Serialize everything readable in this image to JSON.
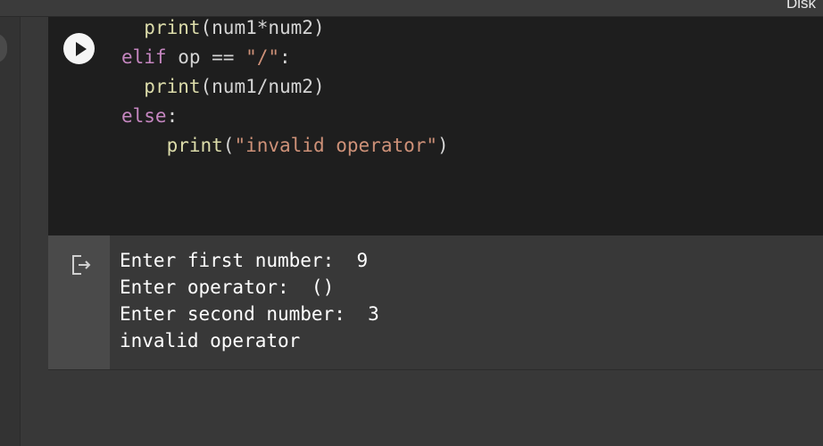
{
  "header": {
    "right_text": "Disk"
  },
  "cell": {
    "run_icon": "play-icon",
    "code_lines": [
      [
        {
          "t": "  ",
          "c": "op"
        },
        {
          "t": "print",
          "c": "fn"
        },
        {
          "t": "(num1*num2)",
          "c": "op"
        }
      ],
      [
        {
          "t": "elif",
          "c": "kw"
        },
        {
          "t": " op == ",
          "c": "op"
        },
        {
          "t": "\"/\"",
          "c": "str"
        },
        {
          "t": ":",
          "c": "op"
        }
      ],
      [
        {
          "t": "  ",
          "c": "op"
        },
        {
          "t": "print",
          "c": "fn"
        },
        {
          "t": "(num1/num2)",
          "c": "op"
        }
      ],
      [
        {
          "t": "else",
          "c": "kw"
        },
        {
          "t": ":",
          "c": "op"
        }
      ],
      [
        {
          "t": "    ",
          "c": "op"
        },
        {
          "t": "print",
          "c": "fn"
        },
        {
          "t": "(",
          "c": "op"
        },
        {
          "t": "\"invalid operator\"",
          "c": "str"
        },
        {
          "t": ")",
          "c": "op"
        }
      ]
    ]
  },
  "output": {
    "icon": "output-clear-icon",
    "lines": [
      "Enter first number:  9",
      "Enter operator:  ()",
      "Enter second number:  3",
      "invalid operator"
    ]
  }
}
